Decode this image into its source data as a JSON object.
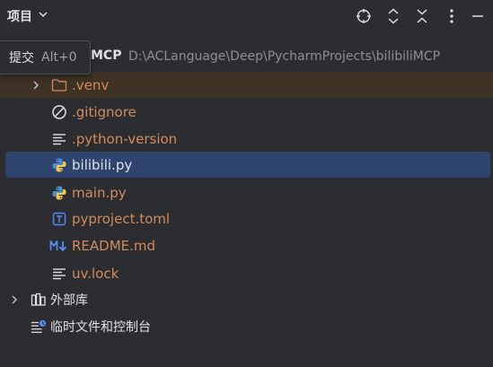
{
  "header": {
    "title": "项目",
    "icons": [
      "locate-icon",
      "expand-icon",
      "collapse-icon",
      "more-options-icon",
      "minimize-icon"
    ]
  },
  "tooltip": {
    "label": "提交",
    "shortcut": "Alt+0"
  },
  "root": {
    "name": "MCP",
    "path": "D:\\ACLanguage\\Deep\\PycharmProjects\\bilibiliMCP"
  },
  "tree": {
    "venv": ".venv",
    "gitignore": ".gitignore",
    "python_version": ".python-version",
    "bilibili": "bilibili.py",
    "main": "main.py",
    "pyproject": "pyproject.toml",
    "readme": "README.md",
    "uvlock": "uv.lock",
    "external_libs": "外部库",
    "scratches": "临时文件和控制台"
  },
  "colors": {
    "background": "#2b2d30",
    "selected_row": "#2e436e",
    "venv_highlight": "#3d3223",
    "modified_text": "#d38b5d",
    "default_text": "#dfe1e5",
    "path_text": "#8c8f94"
  }
}
